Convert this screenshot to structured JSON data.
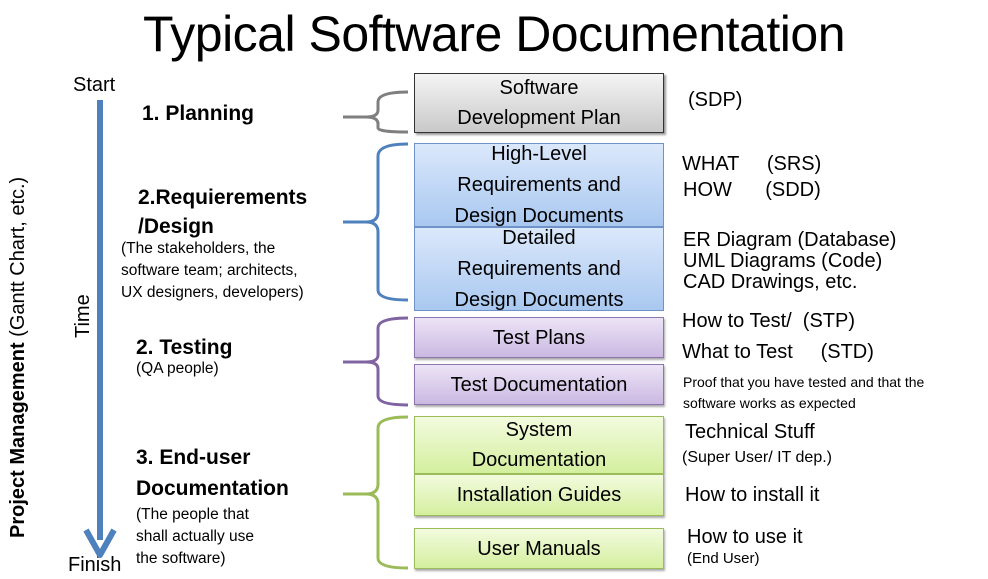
{
  "title": "Typical Software Documentation",
  "side_label": {
    "bold": "Project Management",
    "normal": " (Gantt Chart, etc.)"
  },
  "timeline": {
    "start": "Start",
    "finish": "Finish",
    "axis_label": "Time",
    "color": "#4f81bd"
  },
  "phases": [
    {
      "title": "1. Planning",
      "subtitle_lines": []
    },
    {
      "title_lines": [
        "2.Requierements",
        "/Design"
      ],
      "subtitle_lines": [
        "(The stakeholders, the",
        "software team; architects,",
        "UX designers, developers)"
      ]
    },
    {
      "title": "2. Testing",
      "subtitle_lines": [
        "(QA people)"
      ]
    },
    {
      "title_lines": [
        "3. End-user",
        "Documentation"
      ],
      "subtitle_lines": [
        "(The people that",
        "shall actually use",
        "the software)"
      ]
    }
  ],
  "brace_colors": {
    "planning": "#7f7f7f",
    "requirements": "#4f81bd",
    "testing": "#8064a2",
    "enduser": "#9bbb59"
  },
  "documents": [
    {
      "lines": [
        "Software",
        "Development Plan"
      ],
      "group": "planning"
    },
    {
      "lines": [
        "High-Level",
        "Requirements and",
        "Design Documents"
      ],
      "group": "requirements"
    },
    {
      "lines": [
        "Detailed",
        "Requirements and",
        "Design Documents"
      ],
      "group": "requirements"
    },
    {
      "lines": [
        "Test Plans"
      ],
      "group": "testing"
    },
    {
      "lines": [
        "Test Documentation"
      ],
      "group": "testing"
    },
    {
      "lines": [
        "System",
        "Documentation"
      ],
      "group": "enduser"
    },
    {
      "lines": [
        "Installation Guides"
      ],
      "group": "enduser"
    },
    {
      "lines": [
        "User Manuals"
      ],
      "group": "enduser"
    }
  ],
  "notes": {
    "sdp": "(SDP)",
    "what": "WHAT     (SRS)",
    "how": "HOW      (SDD)",
    "er": "ER Diagram (Database)",
    "uml": "UML Diagrams (Code)",
    "cad": "CAD Drawings, etc.",
    "how_test": "How to Test/  (STP)",
    "what_test": "What to Test     (STD)",
    "proof_1": "Proof that you have tested and that the",
    "proof_2": "software works as expected",
    "technical": "Technical Stuff",
    "super_user": "(Super User/ IT dep.)",
    "install": "How to install it",
    "use": "How to use it",
    "end_user": "(End User)"
  }
}
